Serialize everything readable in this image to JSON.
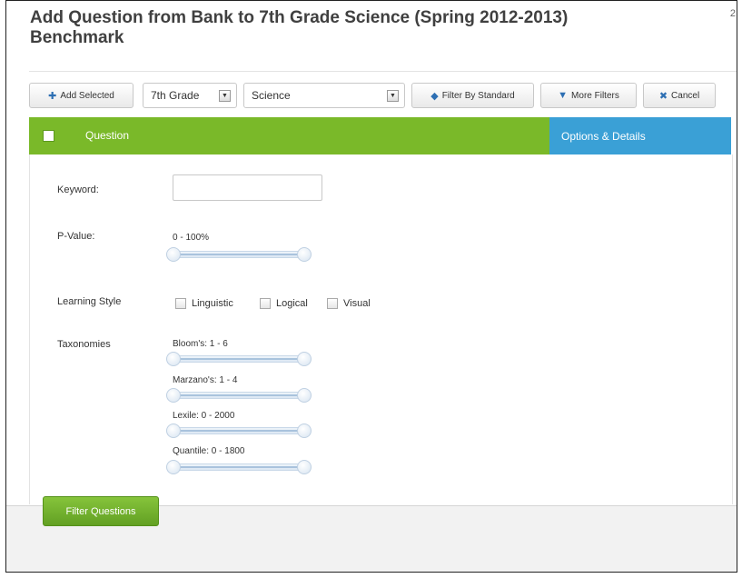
{
  "dialog": {
    "title_line1": "Add Question from Bank to 7th Grade Science (Spring 2012-2013)",
    "title_line2": "Benchmark",
    "corner_text": "2"
  },
  "toolbar": {
    "add_selected": "Add Selected",
    "grade_value": "7th Grade",
    "subject_value": "Science",
    "filter_by_standard": "Filter By Standard",
    "more_filters": "More Filters",
    "cancel": "Cancel"
  },
  "header": {
    "question_label": "Question",
    "options_label": "Options & Details"
  },
  "filters": {
    "keyword_label": "Keyword:",
    "keyword_value": "",
    "pvalue_label": "P-Value:",
    "pvalue_range": "0 - 100%",
    "learning_style_label": "Learning Style",
    "learning_styles": [
      "Linguistic",
      "Logical",
      "Visual"
    ],
    "taxonomies_label": "Taxonomies",
    "taxonomies": [
      {
        "label": "Bloom's: 1 - 6"
      },
      {
        "label": "Marzano's: 1 - 4"
      },
      {
        "label": "Lexile: 0 - 2000"
      },
      {
        "label": "Quantile: 0 - 1800"
      }
    ]
  },
  "actions": {
    "filter_questions": "Filter Questions"
  },
  "colors": {
    "green": "#7ab929",
    "blue": "#3aa0d6"
  },
  "icons": {
    "add": "plus-icon",
    "standard": "tag-icon",
    "filter": "funnel-icon",
    "cancel": "x-icon"
  }
}
